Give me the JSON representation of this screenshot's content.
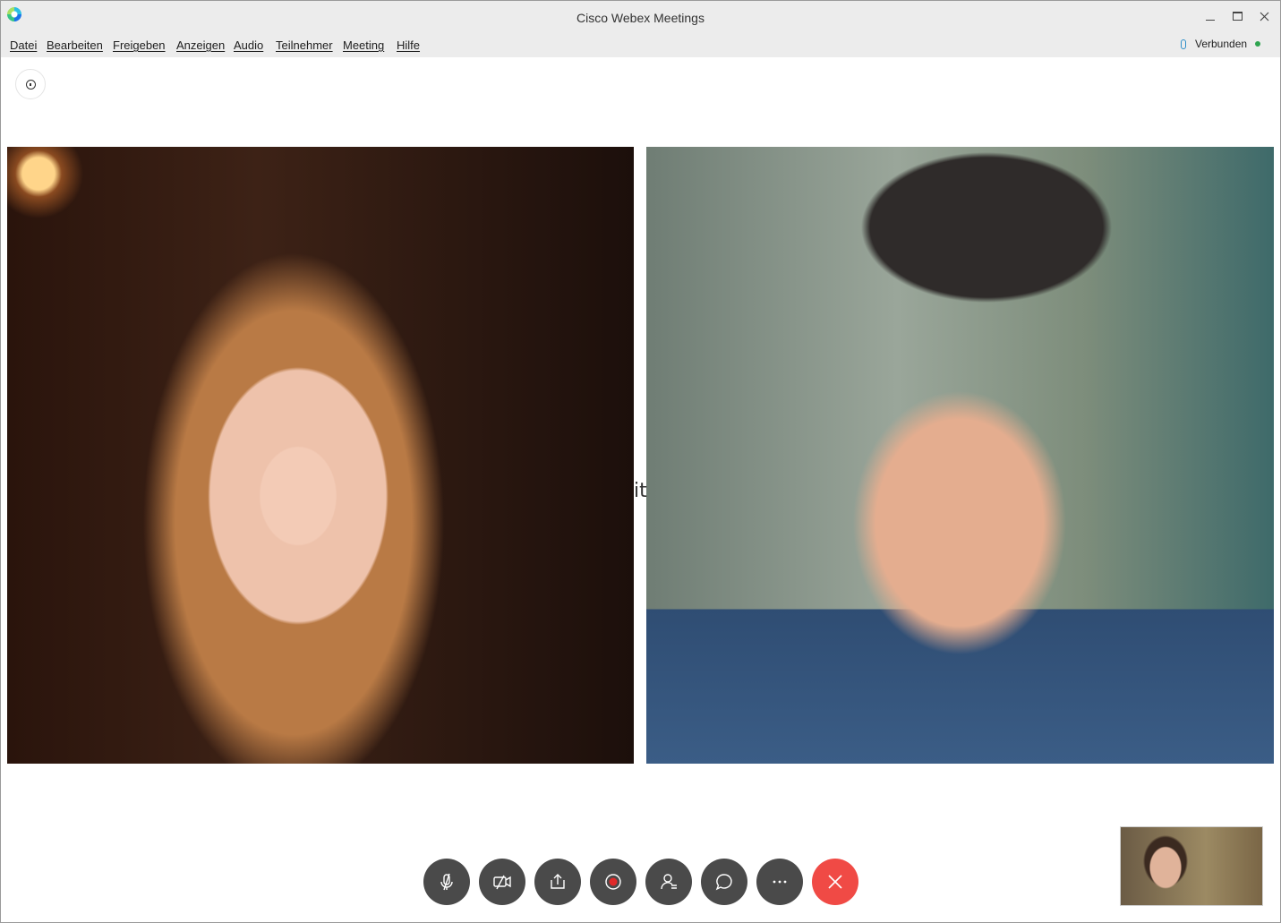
{
  "window": {
    "title": "Cisco Webex Meetings"
  },
  "menu": {
    "items": [
      "Datei",
      "Bearbeiten",
      "Freigeben",
      "Anzeigen",
      "Audio",
      "Teilnehmer",
      "Meeting",
      "Hilfe"
    ]
  },
  "status": {
    "label": "Verbunden",
    "indicator_color": "#2ea44f"
  },
  "stage": {
    "overlay_text": "it"
  },
  "icons": {
    "app": "webex-logo-icon",
    "info": "info-icon",
    "mute": "microphone-muted-icon",
    "video": "video-off-icon",
    "share": "share-icon",
    "record": "record-icon",
    "participants": "participants-icon",
    "chat": "chat-icon",
    "more": "more-icon",
    "end": "end-call-icon"
  },
  "colors": {
    "control_bg": "#4a4a4a",
    "end_call": "#f04a45",
    "record_dot": "#e02a2a",
    "accent": "#2d8ec9"
  }
}
